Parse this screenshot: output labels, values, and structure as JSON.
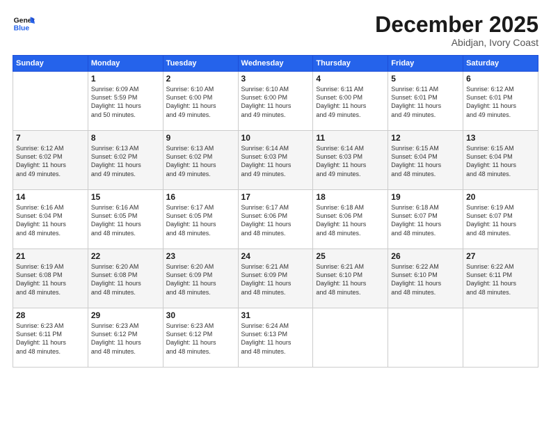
{
  "header": {
    "logo_general": "General",
    "logo_blue": "Blue",
    "month_title": "December 2025",
    "subtitle": "Abidjan, Ivory Coast"
  },
  "weekdays": [
    "Sunday",
    "Monday",
    "Tuesday",
    "Wednesday",
    "Thursday",
    "Friday",
    "Saturday"
  ],
  "weeks": [
    [
      {
        "day": "",
        "info": ""
      },
      {
        "day": "1",
        "info": "Sunrise: 6:09 AM\nSunset: 5:59 PM\nDaylight: 11 hours\nand 50 minutes."
      },
      {
        "day": "2",
        "info": "Sunrise: 6:10 AM\nSunset: 6:00 PM\nDaylight: 11 hours\nand 49 minutes."
      },
      {
        "day": "3",
        "info": "Sunrise: 6:10 AM\nSunset: 6:00 PM\nDaylight: 11 hours\nand 49 minutes."
      },
      {
        "day": "4",
        "info": "Sunrise: 6:11 AM\nSunset: 6:00 PM\nDaylight: 11 hours\nand 49 minutes."
      },
      {
        "day": "5",
        "info": "Sunrise: 6:11 AM\nSunset: 6:01 PM\nDaylight: 11 hours\nand 49 minutes."
      },
      {
        "day": "6",
        "info": "Sunrise: 6:12 AM\nSunset: 6:01 PM\nDaylight: 11 hours\nand 49 minutes."
      }
    ],
    [
      {
        "day": "7",
        "info": "Sunrise: 6:12 AM\nSunset: 6:02 PM\nDaylight: 11 hours\nand 49 minutes."
      },
      {
        "day": "8",
        "info": "Sunrise: 6:13 AM\nSunset: 6:02 PM\nDaylight: 11 hours\nand 49 minutes."
      },
      {
        "day": "9",
        "info": "Sunrise: 6:13 AM\nSunset: 6:02 PM\nDaylight: 11 hours\nand 49 minutes."
      },
      {
        "day": "10",
        "info": "Sunrise: 6:14 AM\nSunset: 6:03 PM\nDaylight: 11 hours\nand 49 minutes."
      },
      {
        "day": "11",
        "info": "Sunrise: 6:14 AM\nSunset: 6:03 PM\nDaylight: 11 hours\nand 49 minutes."
      },
      {
        "day": "12",
        "info": "Sunrise: 6:15 AM\nSunset: 6:04 PM\nDaylight: 11 hours\nand 48 minutes."
      },
      {
        "day": "13",
        "info": "Sunrise: 6:15 AM\nSunset: 6:04 PM\nDaylight: 11 hours\nand 48 minutes."
      }
    ],
    [
      {
        "day": "14",
        "info": "Sunrise: 6:16 AM\nSunset: 6:04 PM\nDaylight: 11 hours\nand 48 minutes."
      },
      {
        "day": "15",
        "info": "Sunrise: 6:16 AM\nSunset: 6:05 PM\nDaylight: 11 hours\nand 48 minutes."
      },
      {
        "day": "16",
        "info": "Sunrise: 6:17 AM\nSunset: 6:05 PM\nDaylight: 11 hours\nand 48 minutes."
      },
      {
        "day": "17",
        "info": "Sunrise: 6:17 AM\nSunset: 6:06 PM\nDaylight: 11 hours\nand 48 minutes."
      },
      {
        "day": "18",
        "info": "Sunrise: 6:18 AM\nSunset: 6:06 PM\nDaylight: 11 hours\nand 48 minutes."
      },
      {
        "day": "19",
        "info": "Sunrise: 6:18 AM\nSunset: 6:07 PM\nDaylight: 11 hours\nand 48 minutes."
      },
      {
        "day": "20",
        "info": "Sunrise: 6:19 AM\nSunset: 6:07 PM\nDaylight: 11 hours\nand 48 minutes."
      }
    ],
    [
      {
        "day": "21",
        "info": "Sunrise: 6:19 AM\nSunset: 6:08 PM\nDaylight: 11 hours\nand 48 minutes."
      },
      {
        "day": "22",
        "info": "Sunrise: 6:20 AM\nSunset: 6:08 PM\nDaylight: 11 hours\nand 48 minutes."
      },
      {
        "day": "23",
        "info": "Sunrise: 6:20 AM\nSunset: 6:09 PM\nDaylight: 11 hours\nand 48 minutes."
      },
      {
        "day": "24",
        "info": "Sunrise: 6:21 AM\nSunset: 6:09 PM\nDaylight: 11 hours\nand 48 minutes."
      },
      {
        "day": "25",
        "info": "Sunrise: 6:21 AM\nSunset: 6:10 PM\nDaylight: 11 hours\nand 48 minutes."
      },
      {
        "day": "26",
        "info": "Sunrise: 6:22 AM\nSunset: 6:10 PM\nDaylight: 11 hours\nand 48 minutes."
      },
      {
        "day": "27",
        "info": "Sunrise: 6:22 AM\nSunset: 6:11 PM\nDaylight: 11 hours\nand 48 minutes."
      }
    ],
    [
      {
        "day": "28",
        "info": "Sunrise: 6:23 AM\nSunset: 6:11 PM\nDaylight: 11 hours\nand 48 minutes."
      },
      {
        "day": "29",
        "info": "Sunrise: 6:23 AM\nSunset: 6:12 PM\nDaylight: 11 hours\nand 48 minutes."
      },
      {
        "day": "30",
        "info": "Sunrise: 6:23 AM\nSunset: 6:12 PM\nDaylight: 11 hours\nand 48 minutes."
      },
      {
        "day": "31",
        "info": "Sunrise: 6:24 AM\nSunset: 6:13 PM\nDaylight: 11 hours\nand 48 minutes."
      },
      {
        "day": "",
        "info": ""
      },
      {
        "day": "",
        "info": ""
      },
      {
        "day": "",
        "info": ""
      }
    ]
  ]
}
